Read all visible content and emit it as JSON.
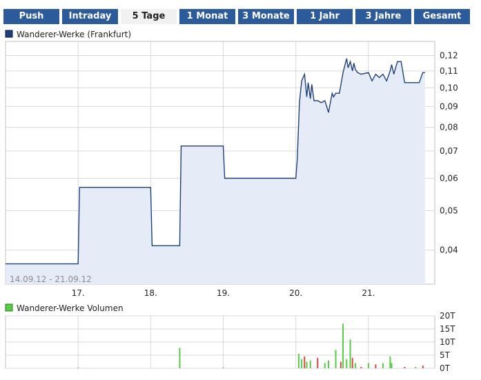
{
  "tabs": [
    {
      "label": "Push",
      "active": false
    },
    {
      "label": "Intraday",
      "active": false
    },
    {
      "label": "5 Tage",
      "active": true
    },
    {
      "label": "1 Monat",
      "active": false
    },
    {
      "label": "3 Monate",
      "active": false
    },
    {
      "label": "1 Jahr",
      "active": false
    },
    {
      "label": "3 Jahre",
      "active": false
    },
    {
      "label": "Gesamt",
      "active": false
    }
  ],
  "colors": {
    "tab_bg": "#2b5b9a",
    "tab_active_bg": "#f1f1f1",
    "price_line": "#1f3f7a",
    "price_fill": "#e6ecf7",
    "volume_up": "#55cc44",
    "volume_down": "#dd4444",
    "grid": "#d9d9d9",
    "legend_price": "#1f3f7a",
    "legend_volume": "#55cc44"
  },
  "chart_data": [
    {
      "type": "area",
      "title": "Wanderer-Werke (Frankfurt)",
      "date_range": "14.09.12 - 21.09.12",
      "y_scale": "log",
      "ylim": [
        0.033,
        0.13
      ],
      "y_ticks": [
        0.04,
        0.05,
        0.06,
        0.07,
        0.08,
        0.09,
        0.1,
        0.11,
        0.12
      ],
      "y_tick_labels": [
        "0,04",
        "0,05",
        "0,06",
        "0,07",
        "0,08",
        "0,09",
        "0,10",
        "0,11",
        "0,12"
      ],
      "x_ticks": [
        17,
        18,
        19,
        20,
        21
      ],
      "x_tick_labels": [
        "17.",
        "18.",
        "19.",
        "20.",
        "21."
      ],
      "xlim": [
        16,
        21.8
      ],
      "grid": true,
      "series": [
        {
          "name": "Wanderer-Werke (Frankfurt)",
          "x": [
            16.0,
            17.0,
            17.02,
            18.0,
            18.02,
            18.4,
            18.42,
            19.0,
            19.02,
            20.0,
            20.02,
            20.05,
            20.08,
            20.12,
            20.15,
            20.17,
            20.2,
            20.22,
            20.25,
            20.3,
            20.35,
            20.4,
            20.45,
            20.5,
            20.52,
            20.55,
            20.6,
            20.65,
            20.7,
            20.72,
            20.75,
            20.78,
            20.8,
            20.82,
            20.85,
            20.9,
            21.0,
            21.05,
            21.1,
            21.15,
            21.2,
            21.25,
            21.3,
            21.32,
            21.35,
            21.4,
            21.45,
            21.5,
            21.55,
            21.6,
            21.7,
            21.75,
            21.78
          ],
          "y": [
            0.037,
            0.037,
            0.057,
            0.057,
            0.041,
            0.041,
            0.072,
            0.072,
            0.06,
            0.06,
            0.067,
            0.092,
            0.104,
            0.108,
            0.095,
            0.103,
            0.094,
            0.102,
            0.093,
            0.093,
            0.092,
            0.093,
            0.087,
            0.097,
            0.095,
            0.097,
            0.097,
            0.109,
            0.118,
            0.112,
            0.116,
            0.11,
            0.115,
            0.111,
            0.109,
            0.108,
            0.109,
            0.104,
            0.108,
            0.106,
            0.108,
            0.104,
            0.11,
            0.114,
            0.108,
            0.116,
            0.116,
            0.103,
            0.103,
            0.103,
            0.103,
            0.109,
            0.109
          ]
        }
      ]
    },
    {
      "type": "bar",
      "title": "Wanderer-Werke Volumen",
      "ylim": [
        0,
        20000
      ],
      "y_ticks": [
        0,
        5000,
        10000,
        15000,
        20000
      ],
      "y_tick_labels": [
        "0T",
        "5T",
        "10T",
        "15T",
        "20T"
      ],
      "xlim": [
        16,
        21.8
      ],
      "grid": true,
      "series": [
        {
          "name": "Wanderer-Werke Volumen",
          "x": [
            17.0,
            18.4,
            19.0,
            20.04,
            20.08,
            20.12,
            20.15,
            20.2,
            20.3,
            20.4,
            20.45,
            20.55,
            20.62,
            20.65,
            20.7,
            20.75,
            20.78,
            20.82,
            20.9,
            21.0,
            21.1,
            21.2,
            21.3,
            21.32,
            21.5,
            21.65,
            21.75
          ],
          "values": [
            300,
            7800,
            300,
            5500,
            3500,
            4500,
            2500,
            3000,
            4000,
            2000,
            3000,
            7000,
            2500,
            17000,
            3500,
            11000,
            4000,
            2000,
            500,
            2000,
            1500,
            2000,
            4500,
            2000,
            500,
            500,
            1000
          ],
          "direction": [
            "up",
            "up",
            "up",
            "up",
            "up",
            "down",
            "up",
            "up",
            "down",
            "up",
            "up",
            "up",
            "down",
            "up",
            "up",
            "up",
            "down",
            "up",
            "down",
            "up",
            "down",
            "up",
            "up",
            "up",
            "down",
            "up",
            "down"
          ]
        }
      ]
    }
  ]
}
